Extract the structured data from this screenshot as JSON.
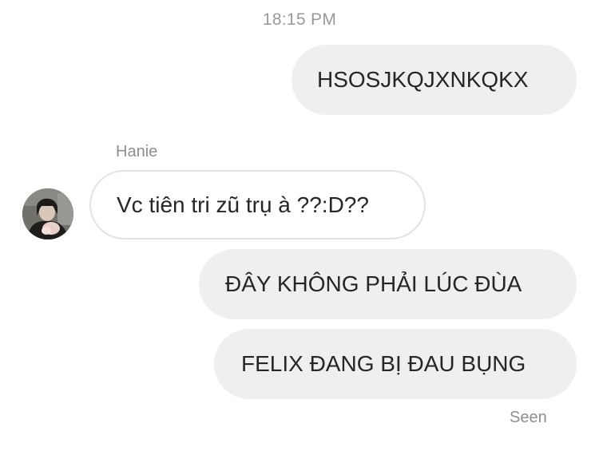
{
  "thread": {
    "timestamp": "18:15 PM",
    "messages": [
      {
        "direction": "outgoing",
        "text": "HSOSJKQJXNKQKX"
      },
      {
        "direction": "incoming",
        "sender": "Hanie",
        "text": "Vc tiên tri zũ trụ à ??:D??"
      },
      {
        "direction": "outgoing",
        "text": "ĐÂY KHÔNG PHẢI LÚC ĐÙA"
      },
      {
        "direction": "outgoing",
        "text": "FELIX ĐANG BỊ ĐAU BỤNG"
      }
    ],
    "seen_label": "Seen"
  },
  "avatar": {
    "icon": "user-photo-avatar"
  },
  "colors": {
    "outgoing_bubble": "#efefef",
    "incoming_border": "#e3e3e3",
    "meta_text": "#8e8e8e",
    "message_text": "#262626"
  }
}
